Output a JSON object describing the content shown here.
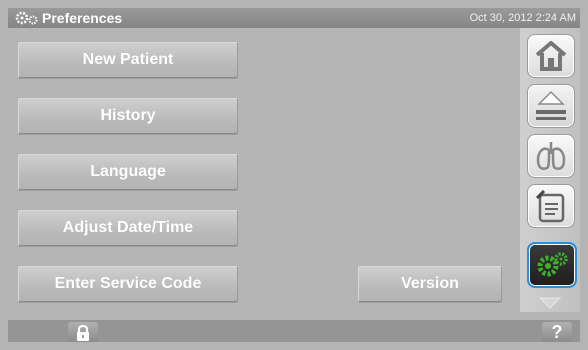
{
  "titlebar": {
    "title": "Preferences",
    "datetime": "Oct 30, 2012 2:24 AM",
    "icon": "gears-icon"
  },
  "menu": {
    "new_patient": "New Patient",
    "history": "History",
    "language": "Language",
    "adjust_datetime": "Adjust Date/Time",
    "service_code": "Enter Service Code",
    "version": "Version"
  },
  "sidebar": {
    "items": [
      {
        "name": "home-icon"
      },
      {
        "name": "eject-icon"
      },
      {
        "name": "lungs-icon"
      },
      {
        "name": "notes-icon"
      },
      {
        "name": "gears-icon",
        "active": true
      },
      {
        "name": "scroll-down-arrow-icon"
      }
    ]
  },
  "bottombar": {
    "lock_icon": "lock-icon",
    "help_label": "?"
  },
  "colors": {
    "active_border": "#2a8fd8",
    "gear_green": "#3fae2a",
    "button_text": "#ffffff"
  }
}
